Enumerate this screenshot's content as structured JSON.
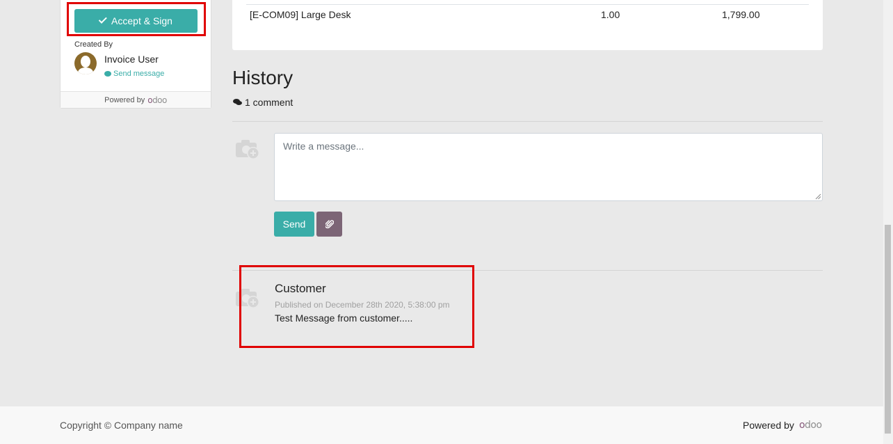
{
  "sidebar": {
    "accept_sign_label": "Accept & Sign",
    "created_by_label": "Created By",
    "user_name": "Invoice User",
    "send_message_label": "Send message",
    "powered_by_label": "Powered by",
    "odoo_brand": "odoo"
  },
  "order_line": {
    "product": "[E-COM09] Large Desk",
    "quantity": "1.00",
    "amount": "1,799.00"
  },
  "history": {
    "title": "History",
    "comment_count": "1 comment",
    "message_placeholder": "Write a message...",
    "send_label": "Send",
    "messages": [
      {
        "author": "Customer",
        "published": "Published on December 28th 2020, 5:38:00 pm",
        "body": "Test Message from customer....."
      }
    ]
  },
  "footer": {
    "copyright": "Copyright © Company name",
    "powered_by_label": "Powered by",
    "odoo_brand": "odoo"
  },
  "colors": {
    "primary": "#3aada8",
    "secondary": "#7c6576",
    "highlight": "#e00000",
    "odoo_purple": "#875a7b"
  },
  "icons": [
    "check-icon",
    "avatar",
    "comment-icon",
    "comments-icon",
    "camera-icon",
    "paperclip-icon"
  ]
}
